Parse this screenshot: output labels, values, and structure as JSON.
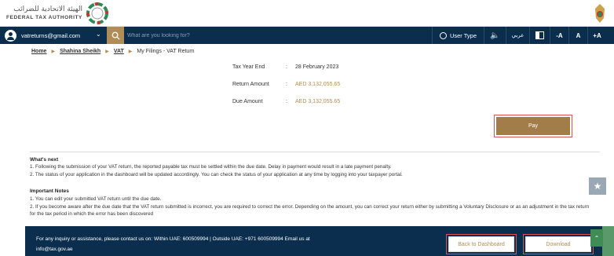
{
  "brand": {
    "arabic_name": "الهيئة الاتحادية للضرائب",
    "english_name": "FEDERAL TAX AUTHORITY",
    "logo_icon": "fta-ring-logo-icon",
    "emblem_icon": "uae-emblem-icon"
  },
  "nav": {
    "user_email": "vatreturns@gmail.com",
    "search_placeholder": "What are you looking for?",
    "user_type_label": "User Type",
    "arabic_label": "عربي",
    "font_decrease": "-A",
    "font_normal": "A",
    "font_increase": "+A"
  },
  "breadcrumb": {
    "items": [
      "Home",
      "Shahina Sheikh",
      "VAT"
    ],
    "current": "My Filings - VAT Return"
  },
  "summary": {
    "rows": [
      {
        "label": "Tax Year End",
        "value": "28 February 2023"
      },
      {
        "label": "Return Amount",
        "value": "AED 3,132,055.65"
      },
      {
        "label": "Due Amount",
        "value": "AED 3,132,055.65"
      }
    ],
    "colon": ":"
  },
  "actions": {
    "pay_label": "Pay"
  },
  "whats_next": {
    "title": "What's next",
    "items": [
      "1. Following the submission of your VAT return, the reported payable tax must be settled within the due date. Delay in payment would result in a late payment penalty.",
      "2. The status of your application in the dashboard will be updated accordingly. You can check the status of your application at any time by logging into your taxpayer portal."
    ]
  },
  "important_notes": {
    "title": "Important Notes",
    "items": [
      "1. You can edit your submitted VAT return until the due date.",
      "2. If you become aware after the due date that the VAT return submitted is incorrect, you are required to correct the error. Depending on the amount, you can correct your return either by submitting a Voluntary Disclosure or as an adjustment in the tax return for the tax period in which the error has been discovered"
    ]
  },
  "footer": {
    "contact_line1": "For any inquiry or assistance, please contact us on: Within UAE: 600509994 | Outside UAE: +971 600509994 Email us at",
    "contact_line2": "info@tax.gov.ae",
    "back_label": "Back to Dashboard",
    "download_label": "Download"
  },
  "colors": {
    "navy": "#0b2e4f",
    "gold": "#b08d57",
    "highlight": "#d9534f"
  }
}
